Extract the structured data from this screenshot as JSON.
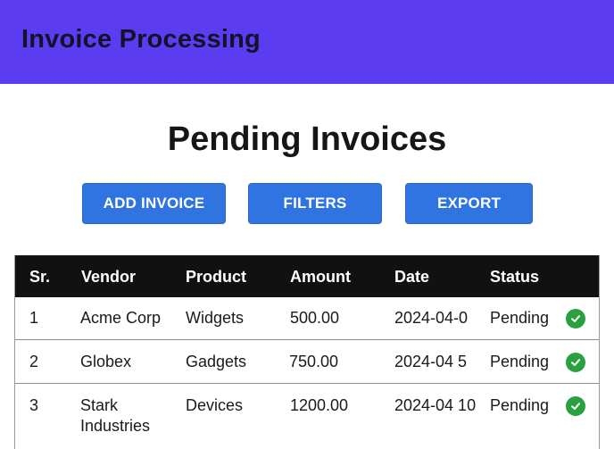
{
  "header": {
    "title": "Invoice Processing"
  },
  "page": {
    "title": "Pending Invoices"
  },
  "toolbar": {
    "add_label": "ADD INVOICE",
    "filters_label": "FILTERS",
    "export_label": "EXPORT"
  },
  "table": {
    "columns": [
      "Sr.",
      "Vendor",
      "Product",
      "Amount",
      "Date",
      "Status"
    ],
    "rows": [
      {
        "sr": "1",
        "vendor": "Acme Corp",
        "product": "Widgets",
        "amount": "500.00",
        "date": "2024-04-0",
        "status": "Pending",
        "status_icon": "check-circle-icon"
      },
      {
        "sr": "2",
        "vendor": "Globex",
        "product": "Gadgets",
        "amount": "750.00",
        "date": "2024-04 5",
        "status": "Pending",
        "status_icon": "check-circle-icon"
      },
      {
        "sr": "3",
        "vendor": "Stark Industries",
        "product": "Devices",
        "amount": "1200.00",
        "date": "2024-04 10",
        "status": "Pending",
        "status_icon": "check-circle-icon"
      }
    ]
  },
  "colors": {
    "header_bg": "#5b3cf0",
    "button_bg": "#2f74e0",
    "table_header_bg": "#111111",
    "status_ok": "#2aa140"
  }
}
